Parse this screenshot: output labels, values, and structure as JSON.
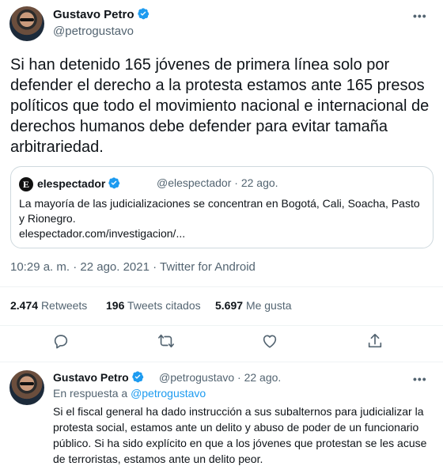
{
  "tweet": {
    "author_name": "Gustavo Petro",
    "author_handle": "@petrogustavo",
    "text": "Si han detenido 165 jóvenes de primera línea solo por defender el derecho a la protesta estamos ante 165 presos políticos que todo el movimiento nacional e internacional de derechos humanos debe defender para evitar tamaña arbitrariedad.",
    "quote": {
      "logo_letter": "E",
      "name": "elespectador",
      "handle_date": "@elespectador · 22 ago.",
      "text": "La mayoría de las judicializaciones se concentran en Bogotá, Cali, Soacha, Pasto y Rionegro.",
      "link": "elespectador.com/investigacion/..."
    },
    "timestamp": "10:29 a. m. · 22 ago. 2021 · Twitter for Android",
    "stats": {
      "retweets_count": "2.474",
      "retweets_label": "Retweets",
      "quotes_count": "196",
      "quotes_label": "Tweets citados",
      "likes_count": "5.697",
      "likes_label": "Me gusta"
    },
    "actions": [
      "reply-icon",
      "retweet-icon",
      "like-icon",
      "share-icon"
    ]
  },
  "reply": {
    "author_name": "Gustavo Petro",
    "meta": "@petrogustavo · 22 ago.",
    "reply_to_prefix": "En respuesta a",
    "reply_to_handle": "@petrogustavo",
    "text": "Si el fiscal general ha dado instrucción a sus subalternos para judicializar la protesta social, estamos ante un delito y abuso de poder de un funcionario público. Si ha sido explícito en que a los jóvenes que protestan se les acuse de terroristas, estamos ante un delito peor."
  },
  "colors": {
    "verified_blue": "#1d9bf0",
    "secondary_text": "#536471",
    "border": "#cfd9de"
  }
}
